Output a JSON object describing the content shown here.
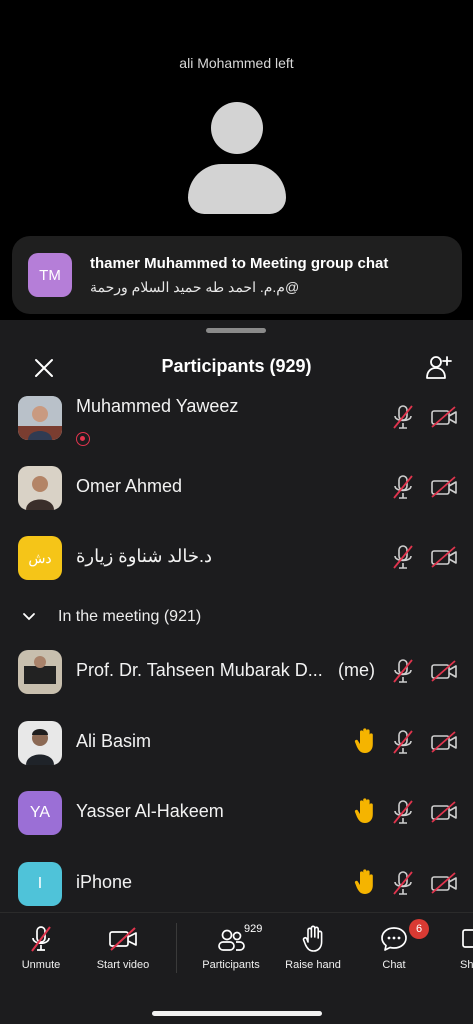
{
  "video": {
    "left_notice": "ali Mohammed left"
  },
  "chat_toast": {
    "avatar_initials": "TM",
    "title": "thamer Muhammed to Meeting group chat",
    "message": "@م.م. احمد طه حميد السلام ورحمة"
  },
  "panel": {
    "title": "Participants (929)",
    "section_label": "In the meeting (921)",
    "me_label": "(me)"
  },
  "participants": [
    {
      "name": "Muhammed Yaweez",
      "avatar": "photo",
      "recording": true,
      "hand_raised": false,
      "muted": true,
      "video_off": true
    },
    {
      "name": "Omer Ahmed",
      "avatar": "photo",
      "hand_raised": false,
      "muted": true,
      "video_off": true
    },
    {
      "name": "د.خالد شناوة زيارة",
      "avatar_initials": "دش",
      "avatar_color": "#f5c518",
      "hand_raised": false,
      "muted": true,
      "video_off": true
    },
    {
      "name": "Prof. Dr. Tahseen Mubarak D...",
      "avatar": "photo",
      "is_me": true,
      "hand_raised": false,
      "muted": true,
      "video_off": true
    },
    {
      "name": "Ali Basim",
      "avatar": "photo",
      "hand_raised": true,
      "muted": true,
      "video_off": true
    },
    {
      "name": "Yasser Al-Hakeem",
      "avatar_initials": "YA",
      "avatar_color": "#9b6fd6",
      "hand_raised": true,
      "muted": true,
      "video_off": true
    },
    {
      "name": "iPhone",
      "avatar_initials": "I",
      "avatar_color": "#4fc3d9",
      "hand_raised": true,
      "muted": true,
      "video_off": true
    }
  ],
  "toolbar": {
    "unmute": "Unmute",
    "start_video": "Start video",
    "participants": "Participants",
    "participants_count": "929",
    "raise_hand": "Raise hand",
    "chat": "Chat",
    "chat_badge": "6",
    "share": "Sh"
  },
  "colors": {
    "muted_slash": "#e0344d",
    "hand": "#f5b400"
  }
}
